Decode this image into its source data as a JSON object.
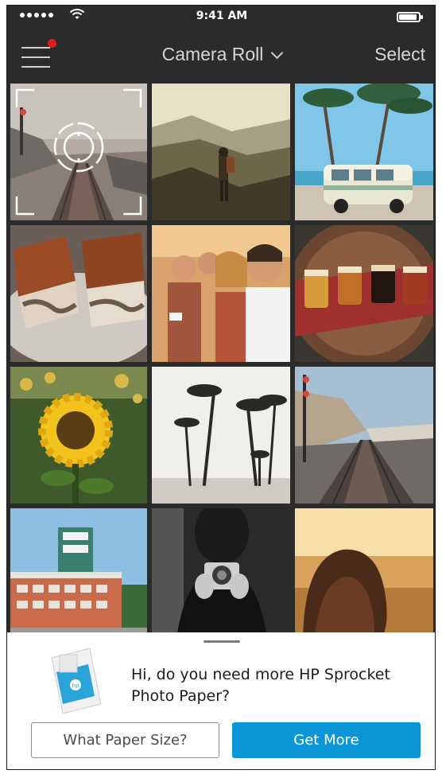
{
  "status_bar": {
    "time": "9:41 AM",
    "signal_icon": "signal-dots-icon",
    "wifi_icon": "wifi-icon",
    "battery_icon": "battery-icon",
    "battery_level": 0.85
  },
  "nav": {
    "menu_icon": "hamburger-menu-icon",
    "notification_color": "#e21b1b",
    "title": "Camera Roll",
    "title_icon": "chevron-down-icon",
    "select_label": "Select"
  },
  "photos": [
    {
      "subject": "railroad-tracks-camera"
    },
    {
      "subject": "hiker-mountain"
    },
    {
      "subject": "palm-trees-van"
    },
    {
      "subject": "sandwiches"
    },
    {
      "subject": "friends-selfie"
    },
    {
      "subject": "beer-flight"
    },
    {
      "subject": "sunflower"
    },
    {
      "subject": "palm-trees-bw"
    },
    {
      "subject": "railroad-coast"
    },
    {
      "subject": "building-sign"
    },
    {
      "subject": "man-with-camera"
    },
    {
      "subject": "woman-sunset"
    }
  ],
  "camera_icon": "camera-capture-icon",
  "promo": {
    "message": "Hi, do you need more HP Sprocket Photo Paper?",
    "secondary_button": "What Paper Size?",
    "primary_button": "Get More",
    "accent_color": "#0a96d7"
  }
}
